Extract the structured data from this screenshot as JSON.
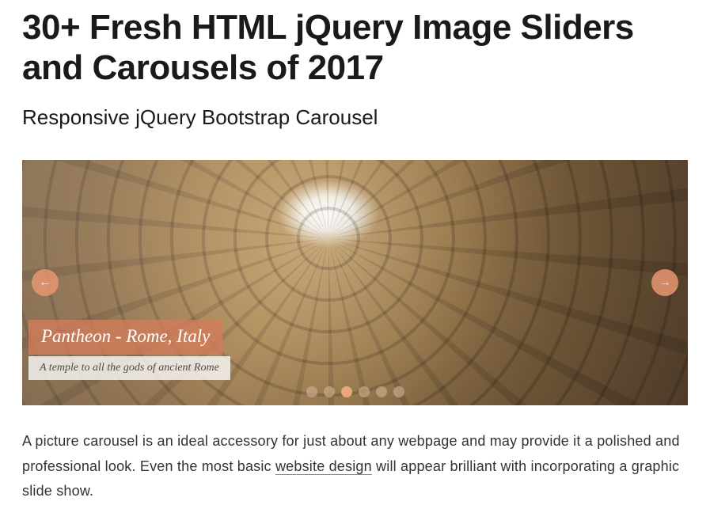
{
  "page": {
    "title": "30+ Fresh HTML jQuery Image Sliders and Carousels of 2017",
    "subtitle": "Responsive jQuery Bootstrap Carousel"
  },
  "carousel": {
    "caption_title": "Pantheon - Rome, Italy",
    "caption_sub": "A temple to all the gods of ancient Rome",
    "slide_count": 6,
    "active_index": 2
  },
  "paragraph": {
    "part1": "A picture carousel is an ideal accessory for just about any webpage and may provide it a polished and professional look. Even the most basic ",
    "link": "website design",
    "part2": " will appear brilliant with incorporating a graphic slide show."
  }
}
